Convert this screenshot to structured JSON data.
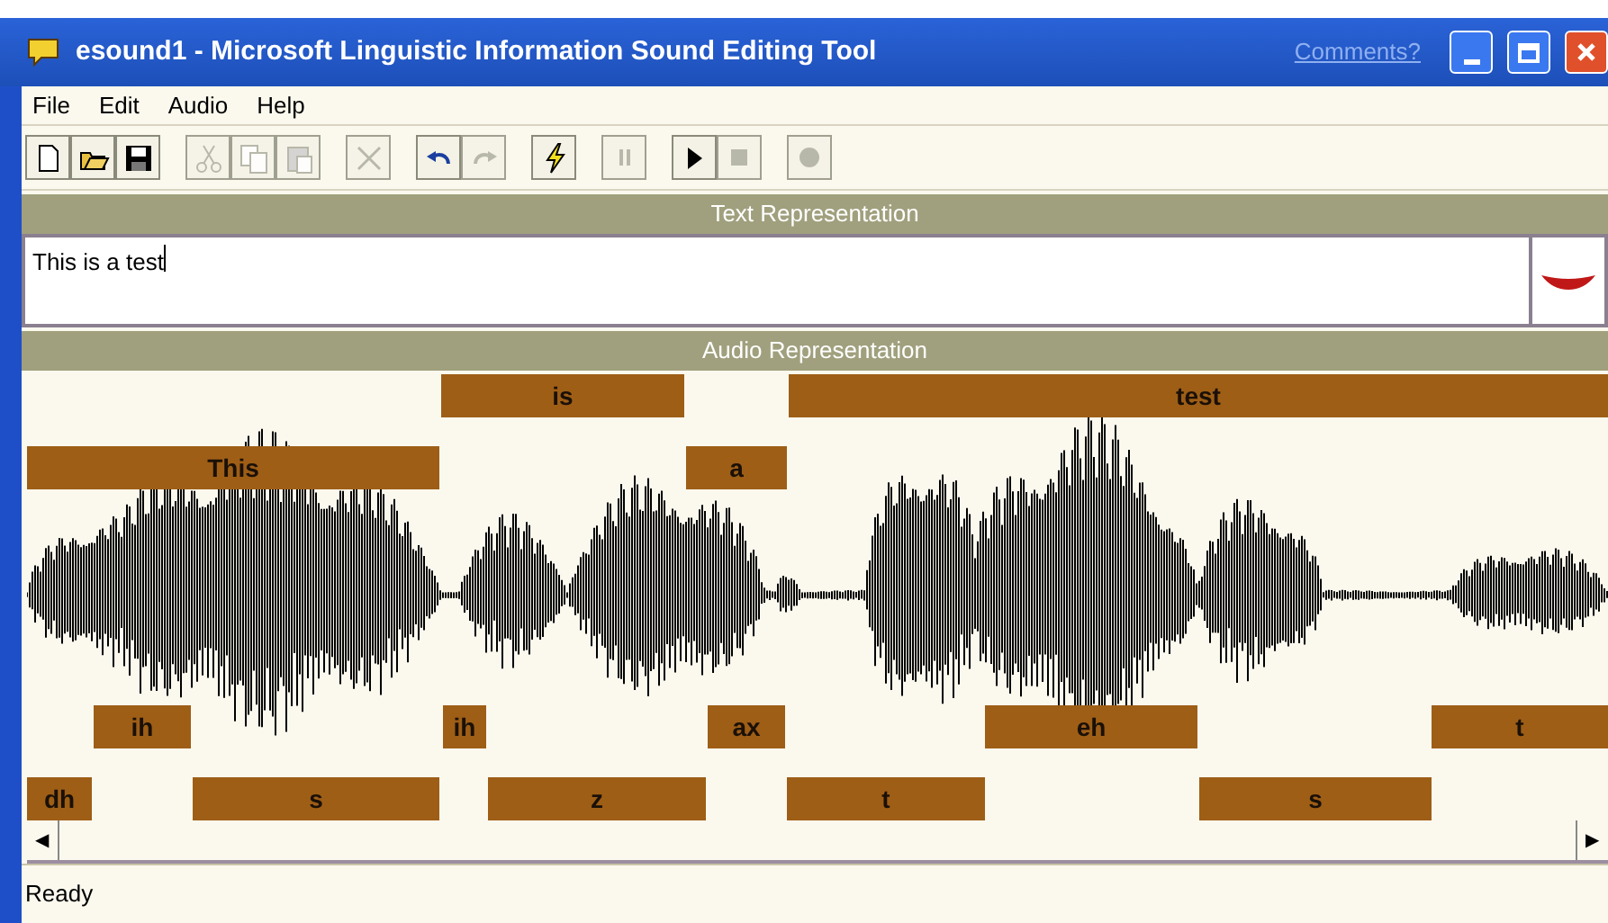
{
  "window": {
    "title": "esound1 - Microsoft Linguistic Information Sound Editing Tool",
    "link": "Comments?"
  },
  "menu": [
    "File",
    "Edit",
    "Audio",
    "Help"
  ],
  "toolbar": [
    {
      "kind": "new",
      "disabled": false
    },
    {
      "kind": "open",
      "disabled": false
    },
    {
      "kind": "save",
      "disabled": false
    },
    {
      "kind": "cut",
      "disabled": true
    },
    {
      "kind": "copy",
      "disabled": true
    },
    {
      "kind": "paste",
      "disabled": true
    },
    {
      "kind": "delete",
      "disabled": true
    },
    {
      "kind": "undo",
      "disabled": false
    },
    {
      "kind": "redo",
      "disabled": true
    },
    {
      "kind": "lightning",
      "disabled": false
    },
    {
      "kind": "pause",
      "disabled": true
    },
    {
      "kind": "play",
      "disabled": false
    },
    {
      "kind": "stop",
      "disabled": true
    },
    {
      "kind": "record",
      "disabled": true
    }
  ],
  "text_panel": {
    "header": "Text Representation",
    "value": "This is a test"
  },
  "audio_panel": {
    "header": "Audio Representation",
    "words": [
      "is",
      "test",
      "This",
      "a"
    ],
    "phonemes": [
      "ih",
      "ih",
      "ax",
      "eh",
      "t",
      "dh",
      "s",
      "z",
      "t",
      "s"
    ]
  },
  "scrollbar": {
    "left": "◀",
    "right": "▶"
  },
  "status_bar": "Ready"
}
